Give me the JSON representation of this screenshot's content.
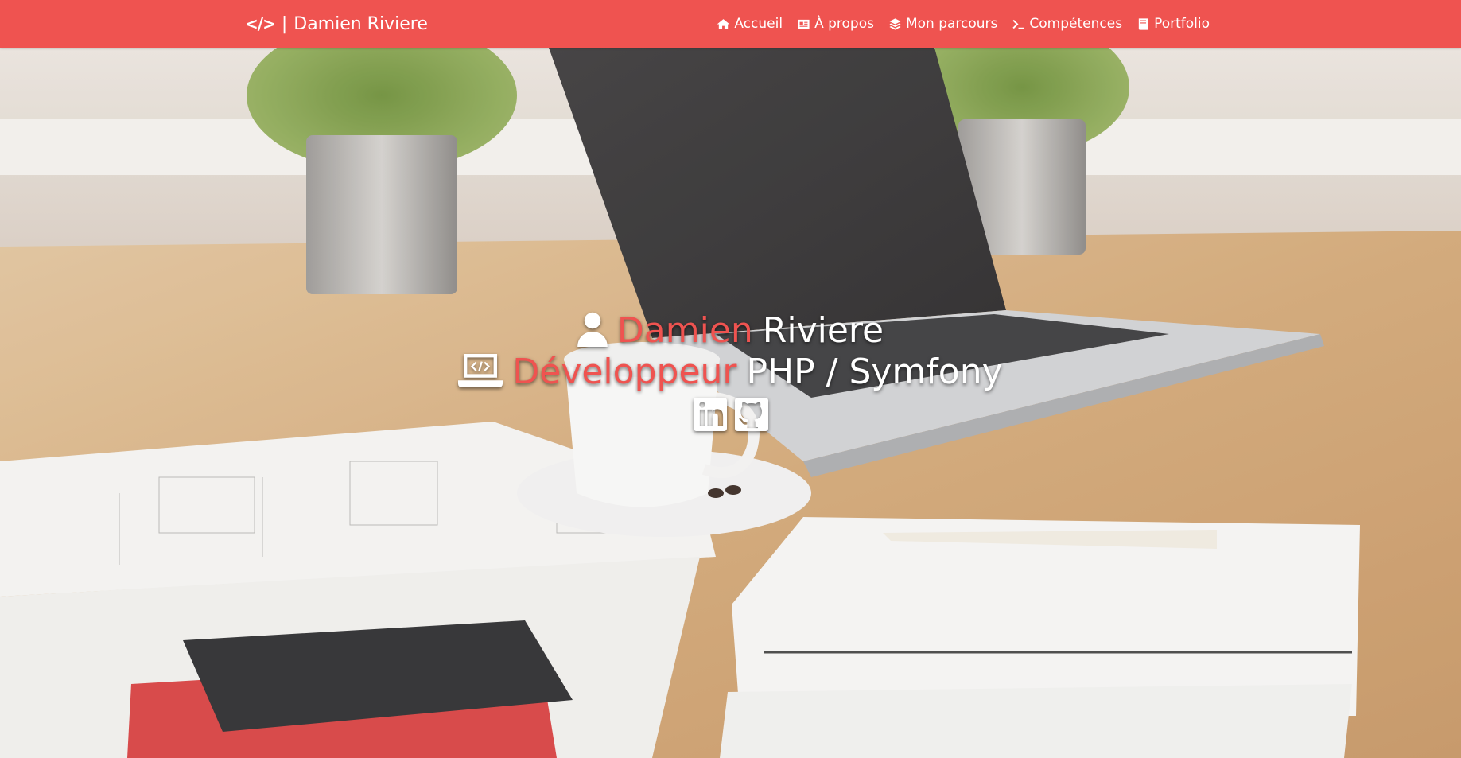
{
  "navbar": {
    "brand_separator": "|",
    "brand_name": "Damien Riviere",
    "links": [
      {
        "label": "Accueil",
        "icon": "home-icon"
      },
      {
        "label": "À propos",
        "icon": "id-card-icon"
      },
      {
        "label": "Mon parcours",
        "icon": "layers-icon"
      },
      {
        "label": "Compétences",
        "icon": "terminal-icon"
      },
      {
        "label": "Portfolio",
        "icon": "book-icon"
      }
    ]
  },
  "hero": {
    "name_first": "Damien",
    "name_last": "Riviere",
    "role_highlight": "Développeur",
    "role_rest": "PHP / Symfony",
    "social": [
      {
        "icon": "linkedin-icon"
      },
      {
        "icon": "github-icon"
      }
    ]
  },
  "colors": {
    "accent": "#ef5350",
    "text": "#ffffff"
  }
}
